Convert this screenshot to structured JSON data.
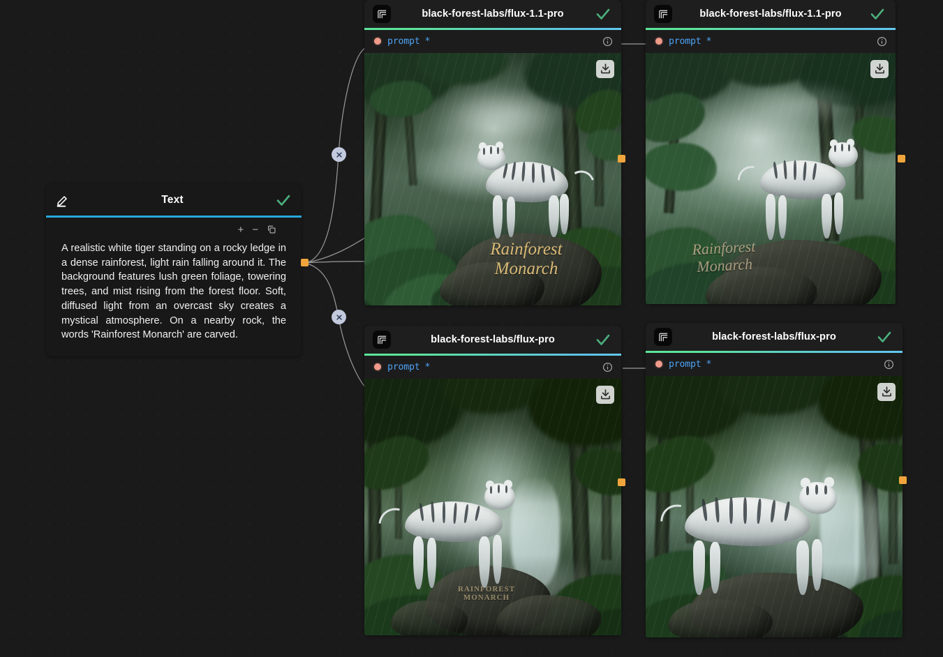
{
  "canvas": {
    "background_color": "#1a1a1a",
    "grid": "dot"
  },
  "text_node": {
    "title": "Text",
    "edit_icon": "pencil-icon",
    "status_icon": "check-icon",
    "accent_color": "#27a8dd",
    "toolbar": {
      "add_label": "+",
      "remove_label": "−",
      "duplicate_icon": "copy-icon"
    },
    "prompt_value": "A realistic white tiger standing on a rocky ledge in a dense rainforest, light rain falling around it. The background features lush green foliage, towering trees, and mist rising from the forest floor. Soft, diffused light from an overcast sky creates a mystical atmosphere. On a nearby rock, the words 'Rainforest Monarch' are carved.",
    "output_port_color": "#f0a53c"
  },
  "edges": {
    "delete_icon": "close-icon",
    "stroke_color": "#9b9b9b",
    "delete_button_color": "#c3cadd"
  },
  "nodes": [
    {
      "id": "flux-11-pro-a",
      "title": "black-forest-labs/flux-1.1-pro",
      "logo_icon": "black-forest-labs-logo-icon",
      "status_icon": "check-icon",
      "accent_from": "#5de59a",
      "accent_to": "#5dc3e8",
      "input": {
        "label": "prompt",
        "required_marker": "*",
        "dot_color": "#f09a8a",
        "info_icon": "info-icon"
      },
      "download_icon": "download-icon",
      "image_caption": "Rainforest\nMonarch"
    },
    {
      "id": "flux-11-pro-b",
      "title": "black-forest-labs/flux-1.1-pro",
      "logo_icon": "black-forest-labs-logo-icon",
      "status_icon": "check-icon",
      "accent_from": "#5de59a",
      "accent_to": "#5dc3e8",
      "input": {
        "label": "prompt",
        "required_marker": "*",
        "dot_color": "#f09a8a",
        "info_icon": "info-icon"
      },
      "download_icon": "download-icon",
      "image_caption": "Rainforest\nMonarch"
    },
    {
      "id": "flux-pro-a",
      "title": "black-forest-labs/flux-pro",
      "logo_icon": "black-forest-labs-logo-icon",
      "status_icon": "check-icon",
      "accent_from": "#5de59a",
      "accent_to": "#5dc3e8",
      "input": {
        "label": "prompt",
        "required_marker": "*",
        "dot_color": "#f09a8a",
        "info_icon": "info-icon"
      },
      "download_icon": "download-icon",
      "image_caption": "RAINFOREST\nMONARCH"
    },
    {
      "id": "flux-pro-b",
      "title": "black-forest-labs/flux-pro",
      "logo_icon": "black-forest-labs-logo-icon",
      "status_icon": "check-icon",
      "accent_from": "#5de59a",
      "accent_to": "#5dc3e8",
      "input": {
        "label": "prompt",
        "required_marker": "*",
        "dot_color": "#f09a8a",
        "info_icon": "info-icon"
      },
      "download_icon": "download-icon",
      "image_caption": ""
    }
  ]
}
